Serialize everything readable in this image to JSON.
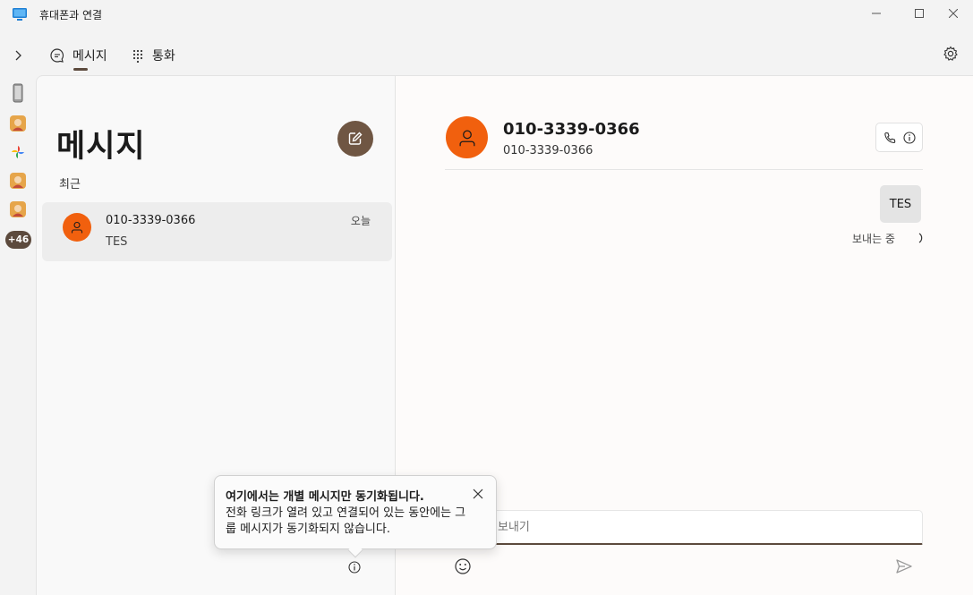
{
  "window": {
    "title": "휴대폰과 연결",
    "icon": "phone-link-app-icon",
    "controls": [
      "minimize",
      "maximize",
      "close"
    ]
  },
  "nav": {
    "tabs": [
      {
        "label": "메시지",
        "icon": "chat-bubble-icon",
        "selected": true
      },
      {
        "label": "통화",
        "icon": "dialpad-icon",
        "selected": false
      }
    ],
    "accent_color": "#5c4a3d"
  },
  "rail": {
    "items": [
      "phone-device-icon",
      "app-icon-1",
      "photos-icon",
      "app-icon-2",
      "app-icon-3"
    ],
    "more_badge": "+46"
  },
  "list": {
    "heading": "메시지",
    "recent_label": "최근",
    "conversations": [
      {
        "name": "010-3339-0366",
        "preview": "TES",
        "date": "오늘",
        "avatar_color": "#f1600e"
      }
    ]
  },
  "chat": {
    "name": "010-3339-0366",
    "number": "010-3339-0366",
    "messages": [
      {
        "text": "TES",
        "status": "보내는 중"
      }
    ],
    "compose_placeholder": "보내기"
  },
  "tooltip": {
    "title": "여기에서는 개별 메시지만 동기화됩니다.",
    "body": "전화 링크가 열려 있고 연결되어 있는 동안에는 그룹 메시지가 동기화되지 않습니다."
  }
}
